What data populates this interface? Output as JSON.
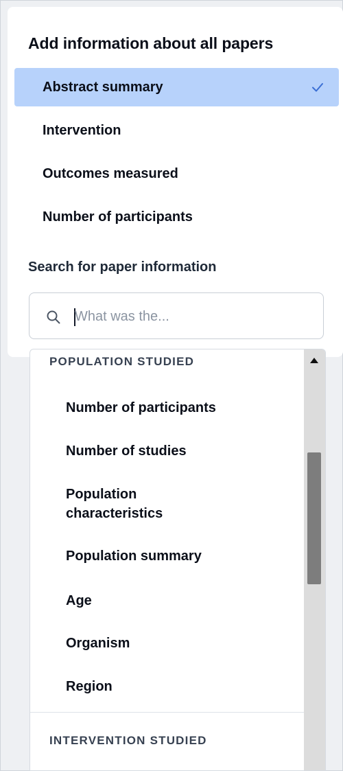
{
  "panel": {
    "title": "Add information about all papers",
    "options": [
      {
        "label": "Abstract summary",
        "selected": true
      },
      {
        "label": "Intervention",
        "selected": false
      },
      {
        "label": "Outcomes measured",
        "selected": false
      },
      {
        "label": "Number of participants",
        "selected": false
      }
    ],
    "selected_icon": "check-icon",
    "accent_color": "#b7d2fb"
  },
  "search": {
    "label": "Search for paper information",
    "placeholder": "What was the...",
    "value": "",
    "icon": "search-icon"
  },
  "dropdown": {
    "groups": [
      {
        "header": "POPULATION STUDIED",
        "items": [
          "Number of participants",
          "Number of studies",
          "Population characteristics",
          "Population summary",
          "Age",
          "Organism",
          "Region"
        ]
      },
      {
        "header": "INTERVENTION STUDIED",
        "items": []
      }
    ],
    "scroll_up_icon": "triangle-up-icon"
  }
}
